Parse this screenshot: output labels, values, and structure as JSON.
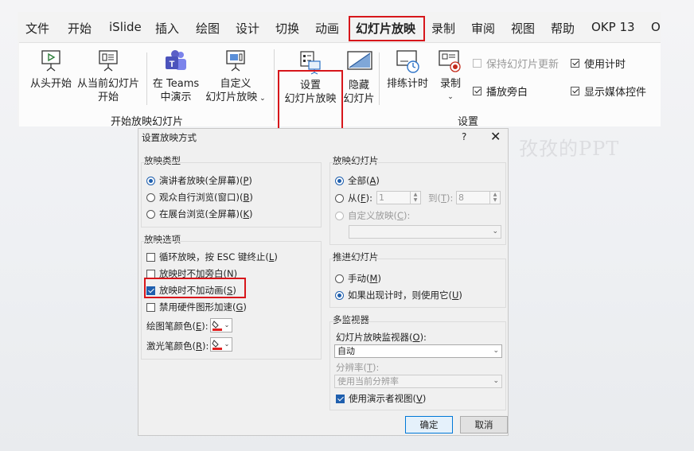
{
  "ribbon": {
    "tabs": [
      "文件",
      "开始",
      "iSlide",
      "插入",
      "绘图",
      "设计",
      "切换",
      "动画",
      "幻灯片放映",
      "录制",
      "审阅",
      "视图",
      "帮助",
      "OKP 13",
      "O"
    ],
    "active_tab": "幻灯片放映",
    "start_group": {
      "label": "开始放映幻灯片",
      "from_beginning": "从头开始",
      "from_current_line1": "从当前幻灯片",
      "from_current_line2": "开始",
      "teams_line1": "在 Teams",
      "teams_line2": "中演示",
      "custom_line1": "自定义",
      "custom_line2": "幻灯片放映"
    },
    "setup_group": {
      "label": "设置",
      "setup_line1": "设置",
      "setup_line2": "幻灯片放映",
      "hide_line1": "隐藏",
      "hide_line2": "幻灯片",
      "rehearse": "排练计时",
      "record": "录制",
      "keep_updated": "保持幻灯片更新",
      "play_narrations": "播放旁白",
      "use_timings": "使用计时",
      "show_media_controls": "显示媒体控件"
    }
  },
  "watermark": "孜孜的PPT",
  "dialog": {
    "title": "设置放映方式",
    "help": "?",
    "close": "✕",
    "show_type": {
      "label": "放映类型",
      "options": [
        "演讲者放映(全屏幕)(",
        "观众自行浏览(窗口)(",
        "在展台浏览(全屏幕)("
      ],
      "keys": [
        "P",
        "B",
        "K"
      ],
      "selected": 0
    },
    "show_options": {
      "label": "放映选项",
      "loop": "循环放映，按 ESC 键终止(",
      "loop_key": "L",
      "no_narration": "放映时不加旁白(",
      "no_narration_key": "N",
      "no_animation": "放映时不加动画(",
      "no_animation_key": "S",
      "no_hw": "禁用硬件图形加速(",
      "no_hw_key": "G",
      "pen_color": "绘图笔颜色(",
      "pen_key": "E",
      "laser_color": "激光笔颜色(",
      "laser_key": "R",
      "pen_color_value": "#e02020",
      "laser_color_value": "#e02020"
    },
    "show_slides": {
      "label": "放映幻灯片",
      "all": "全部(",
      "all_key": "A",
      "from": "从(",
      "from_key": "F",
      "from_value": "1",
      "to": "到(",
      "to_key": "T",
      "to_value": "8",
      "custom": "自定义放映(",
      "custom_key": "C"
    },
    "advance": {
      "label": "推进幻灯片",
      "manual": "手动(",
      "manual_key": "M",
      "timings": "如果出现计时，则使用它(",
      "timings_key": "U"
    },
    "monitors": {
      "label": "多监视器",
      "monitor_label": "幻灯片放映监视器(",
      "monitor_key": "O",
      "monitor_value": "自动",
      "resolution_label": "分辨率(",
      "resolution_key": "T",
      "resolution_value": "使用当前分辨率",
      "presenter_view": "使用演示者视图(",
      "presenter_key": "V"
    },
    "ok": "确定",
    "cancel": "取消"
  },
  "colors": {
    "highlight": "#d7161b",
    "accent": "#1f5fae"
  }
}
